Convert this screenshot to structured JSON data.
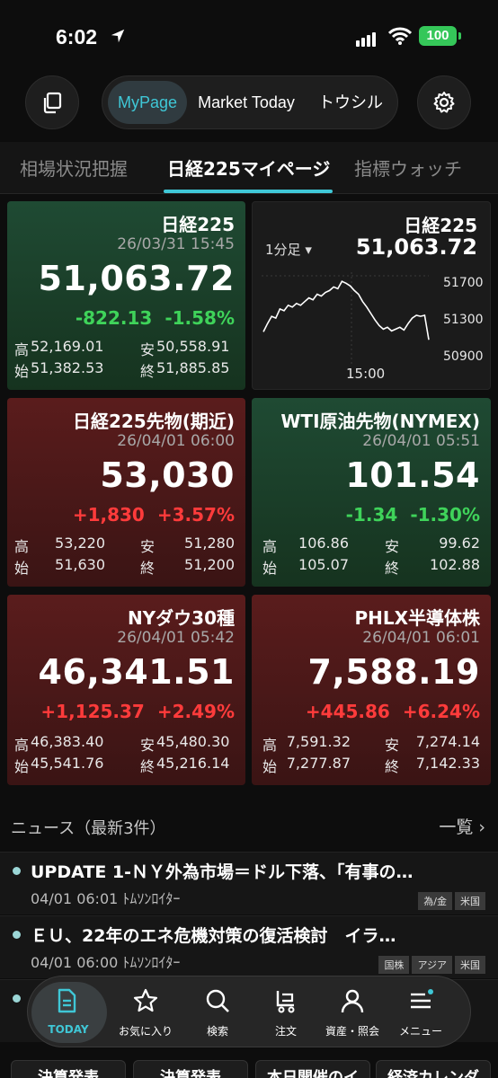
{
  "status": {
    "time": "6:02",
    "battery": "100"
  },
  "nav": {
    "tabs": [
      "MyPage",
      "Market Today",
      "トウシル"
    ]
  },
  "subtabs": [
    "相場状況把握",
    "日経225マイページ",
    "指標ウォッチ"
  ],
  "cards": [
    {
      "name": "日経225",
      "datetime": "26/03/31 15:45",
      "price": "51,063.72",
      "change": "-822.13",
      "change_pct": "-1.58%",
      "direction": "down",
      "high_label": "高",
      "high": "52,169.01",
      "low_label": "安",
      "low": "50,558.91",
      "open_label": "始",
      "open": "51,382.53",
      "close_label": "終",
      "close": "51,885.85"
    },
    {
      "name": "日経225先物(期近)",
      "datetime": "26/04/01 06:00",
      "price": "53,030",
      "change": "+1,830",
      "change_pct": "+3.57%",
      "direction": "up",
      "high_label": "高",
      "high": "53,220",
      "low_label": "安",
      "low": "51,280",
      "open_label": "始",
      "open": "51,630",
      "close_label": "終",
      "close": "51,200"
    },
    {
      "name": "WTI原油先物(NYMEX)",
      "datetime": "26/04/01 05:51",
      "price": "101.54",
      "change": "-1.34",
      "change_pct": "-1.30%",
      "direction": "down",
      "high_label": "高",
      "high": "106.86",
      "low_label": "安",
      "low": "99.62",
      "open_label": "始",
      "open": "105.07",
      "close_label": "終",
      "close": "102.88"
    },
    {
      "name": "NYダウ30種",
      "datetime": "26/04/01 05:42",
      "price": "46,341.51",
      "change": "+1,125.37",
      "change_pct": "+2.49%",
      "direction": "up",
      "high_label": "高",
      "high": "46,383.40",
      "low_label": "安",
      "low": "45,480.30",
      "open_label": "始",
      "open": "45,541.76",
      "close_label": "終",
      "close": "45,216.14"
    },
    {
      "name": "PHLX半導体株",
      "datetime": "26/04/01 06:01",
      "price": "7,588.19",
      "change": "+445.86",
      "change_pct": "+6.24%",
      "direction": "up",
      "high_label": "高",
      "high": "7,591.32",
      "low_label": "安",
      "low": "7,274.14",
      "open_label": "始",
      "open": "7,277.87",
      "close_label": "終",
      "close": "7,142.33"
    }
  ],
  "chart_card": {
    "name": "日経225",
    "price": "51,063.72",
    "timeframe": "1分足"
  },
  "chart_data": {
    "type": "line",
    "ylim": [
      50900,
      51800
    ],
    "yticks": [
      "51700",
      "51300",
      "50900"
    ],
    "xticks": [
      "15:00"
    ],
    "values": [
      51150,
      51240,
      51320,
      51300,
      51400,
      51380,
      51440,
      51420,
      51460,
      51440,
      51480,
      51520,
      51500,
      51560,
      51540,
      51580,
      51600,
      51640,
      51620,
      51700,
      51680,
      51650,
      51600,
      51560,
      51480,
      51420,
      51350,
      51280,
      51220,
      51180,
      51200,
      51160,
      51180,
      51200,
      51170,
      51240,
      51300,
      51330,
      51320,
      51330,
      51063
    ]
  },
  "news": {
    "header": "ニュース（最新3件）",
    "more": "一覧",
    "items": [
      {
        "title": "UPDATE 1-ＮＹ外為市場＝ドル下落、「有事の…",
        "time": "04/01 06:01",
        "source": "ﾄﾑｿﾝﾛｲﾀｰ",
        "tags": [
          "為/金",
          "米国"
        ]
      },
      {
        "title": "ＥＵ、22年のエネ危機対策の復活検討　イラ…",
        "time": "04/01 06:00",
        "source": "ﾄﾑｿﾝﾛｲﾀｰ",
        "tags": [
          "国株",
          "アジア",
          "米国"
        ]
      }
    ]
  },
  "tabbar": [
    {
      "label": "TODAY",
      "icon": "document-icon"
    },
    {
      "label": "お気に入り",
      "icon": "star-icon"
    },
    {
      "label": "検索",
      "icon": "search-icon"
    },
    {
      "label": "注文",
      "icon": "cart-icon"
    },
    {
      "label": "資産・照会",
      "icon": "person-icon"
    },
    {
      "label": "メニュー",
      "icon": "menu-icon"
    }
  ],
  "bottom_buttons": [
    "決算発表",
    "決算発表",
    "本日開催のイ",
    "経済カレンダ"
  ]
}
